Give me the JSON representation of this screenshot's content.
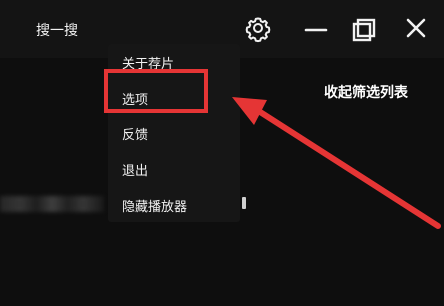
{
  "topbar": {
    "search_tab_label": "搜一搜"
  },
  "window_controls": {
    "settings_icon": "gear-icon",
    "minimize_icon": "minimize-icon",
    "restore_icon": "restore-icon",
    "close_icon": "close-icon"
  },
  "menu": {
    "items": [
      {
        "label": "关于荐片"
      },
      {
        "label": "选项"
      },
      {
        "label": "反馈"
      },
      {
        "label": "退出"
      },
      {
        "label": "隐藏播放器"
      }
    ]
  },
  "content": {
    "collapse_filter_label": "收起筛选列表",
    "partial_text_label": "I"
  },
  "annotations": {
    "highlight_color": "#e53535",
    "arrow_color": "#e53535"
  }
}
